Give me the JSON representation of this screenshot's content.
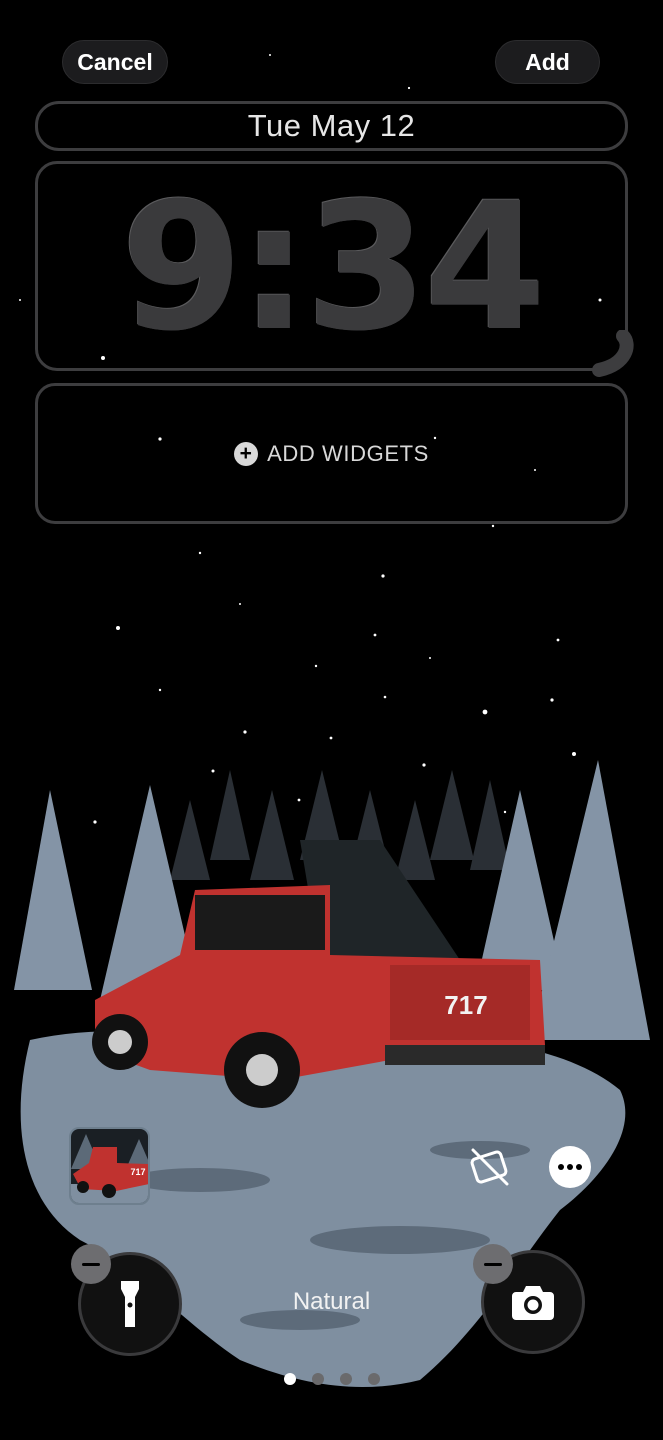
{
  "header": {
    "cancel_label": "Cancel",
    "add_label": "Add"
  },
  "lock_screen": {
    "date": "Tue May 12",
    "time": "9:34",
    "widgets_label": "ADD WIDGETS"
  },
  "wallpaper": {
    "plate_text": "717",
    "truck_color": "#c0322f"
  },
  "controls": {
    "left_quick_action": "flashlight-icon",
    "right_quick_action": "camera-icon",
    "style_label": "Natural",
    "page_count": 4,
    "active_page": 1
  },
  "colors": {
    "frame": "#3d3d3f",
    "snow": "#7f8fa0"
  }
}
